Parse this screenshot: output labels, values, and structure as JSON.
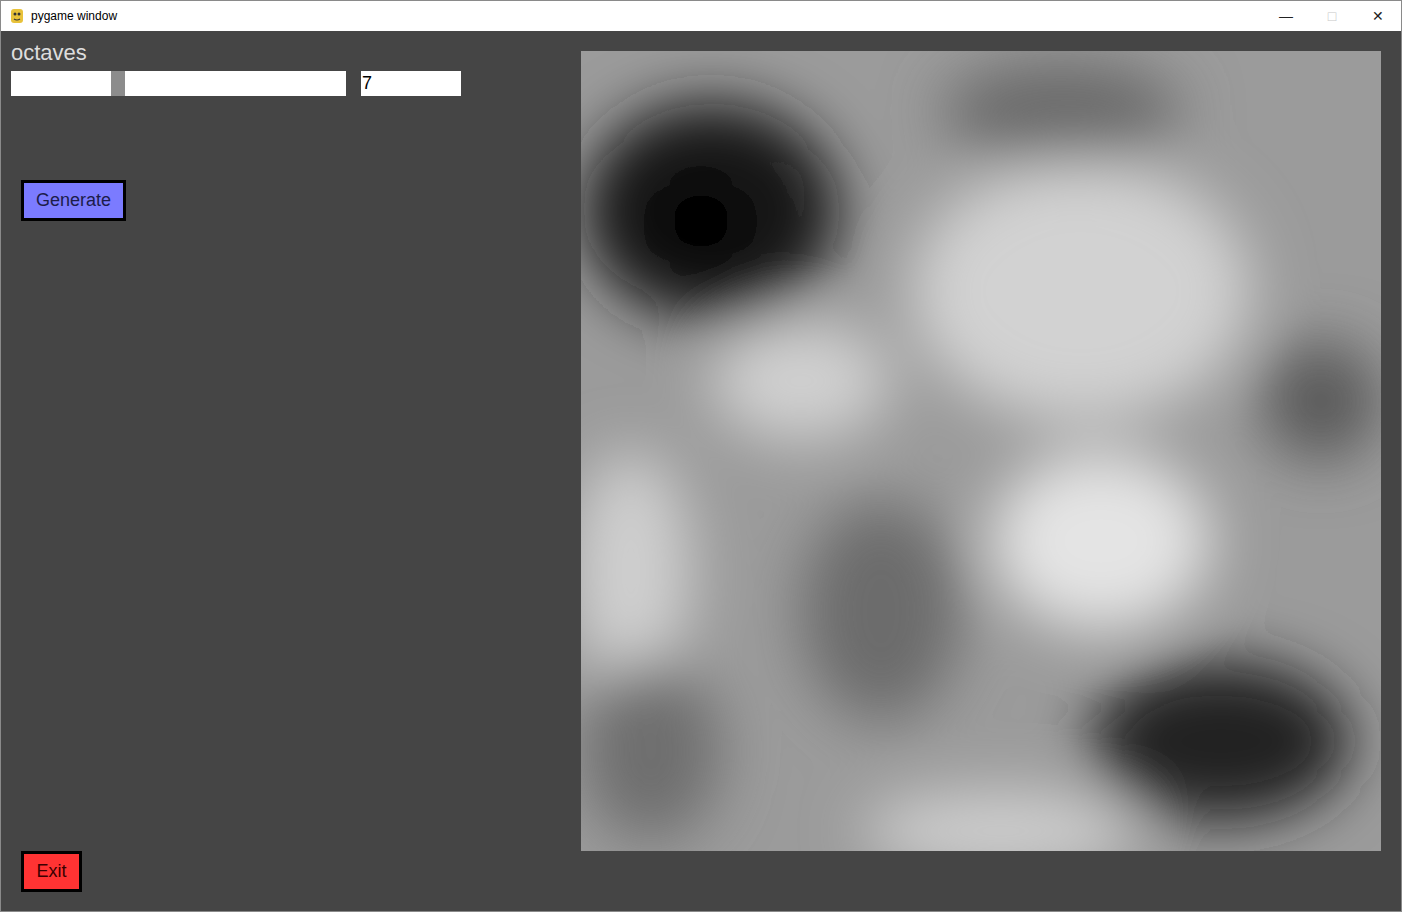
{
  "window": {
    "title": "pygame window",
    "controls": [
      {
        "label": "—",
        "disabled": false
      },
      {
        "label": "□",
        "disabled": true
      },
      {
        "label": "✕",
        "disabled": false
      }
    ]
  },
  "controls": [
    {
      "label": "octaves",
      "level": 0.32,
      "value": "7"
    }
  ],
  "buttons": [
    {
      "label": "Generate",
      "color": "#7b7bff"
    },
    {
      "label": "Exit",
      "color": "#ff3333"
    }
  ]
}
